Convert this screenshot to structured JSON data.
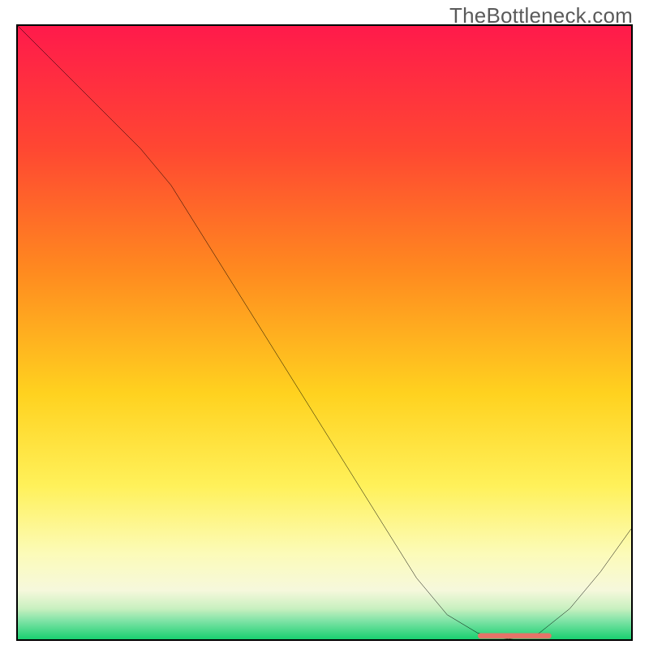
{
  "watermark": "TheBottleneck.com",
  "chart_data": {
    "type": "line",
    "title": "",
    "xlabel": "",
    "ylabel": "",
    "xlim": [
      0,
      100
    ],
    "ylim": [
      0,
      100
    ],
    "series": [
      {
        "name": "curve",
        "x": [
          0,
          5,
          10,
          15,
          20,
          25,
          30,
          35,
          40,
          45,
          50,
          55,
          60,
          65,
          70,
          75,
          80,
          85,
          90,
          95,
          100
        ],
        "y": [
          100,
          95,
          90,
          85,
          80,
          74,
          66,
          58,
          50,
          42,
          34,
          26,
          18,
          10,
          4,
          1,
          0,
          1,
          5,
          11,
          18
        ]
      }
    ],
    "flat_region_x": [
      75,
      87
    ],
    "gradient_stops": [
      {
        "offset": 0,
        "color": "#ff1a4b"
      },
      {
        "offset": 20,
        "color": "#ff4732"
      },
      {
        "offset": 40,
        "color": "#ff8a1f"
      },
      {
        "offset": 60,
        "color": "#ffd21f"
      },
      {
        "offset": 75,
        "color": "#fff15a"
      },
      {
        "offset": 86,
        "color": "#fcfbb8"
      },
      {
        "offset": 92,
        "color": "#f6f8dc"
      },
      {
        "offset": 95,
        "color": "#c9f0c0"
      },
      {
        "offset": 97,
        "color": "#7fe3a6"
      },
      {
        "offset": 100,
        "color": "#19d070"
      }
    ],
    "flat_marker_color": "#e57368"
  }
}
